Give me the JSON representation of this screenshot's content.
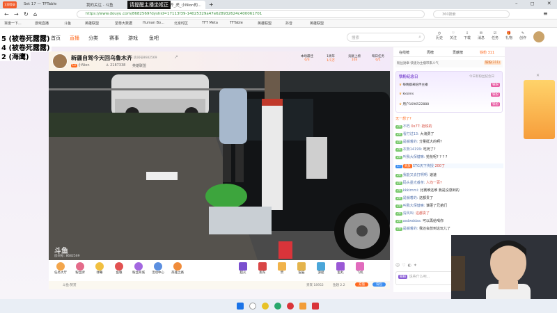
{
  "browser": {
    "login_button": "立即登录",
    "tabs": [
      {
        "label": "Set 17 — TFTable"
      },
      {
        "label": "我的关注 - 斗鱼"
      },
      {
        "label": "请提醒主播坐姬正"
      },
      {
        "label": "新疆自驾今天回乌鲁木齐_虎_小Nion的..."
      }
    ],
    "url": "https://www.douyu.com/8682569?dyshid=17113f39-14025329a47e628932624c400061701",
    "search_placeholder": "360搜索",
    "bookmarks": [
      "百度一下...",
      "游戏直播",
      "斗鱼",
      "英雄联盟",
      "至尊大数据",
      "Human Bo...",
      "北京时区",
      "TFT Meta",
      "TFTable",
      "英雄联盟",
      "抖音",
      "英雄联盟"
    ]
  },
  "overlay": {
    "tab_warning": "请提醒主播坐姬正",
    "lines": [
      "5 (被卷死露露)",
      "4 (被卷死露露)",
      "2 (海鹰)"
    ]
  },
  "site": {
    "nav": [
      "首页",
      "直播",
      "分类",
      "赛事",
      "游戏",
      "鱼吧"
    ],
    "search_placeholder": "搜索",
    "user_items": [
      "历史",
      "关注",
      "下载",
      "消息",
      "任务",
      "礼物",
      "创作"
    ]
  },
  "stream": {
    "title": "新疆自驾今天回乌鲁木齐",
    "room_id": "房间号8682569",
    "streamer": "小Nion",
    "followers": "2187338",
    "category": "英雄联盟",
    "stats": [
      {
        "label": "本场最佳",
        "value": "0/3"
      },
      {
        "label": "1周年",
        "value": "1/1万"
      },
      {
        "label": "贡献上榜",
        "value": "103"
      },
      {
        "label": "每日任务",
        "value": "0/1"
      }
    ],
    "watermark": "斗鱼",
    "room_label": "房间号: 8682569",
    "info": [
      "斗鱼:赞赏",
      "贵宾 18952",
      "鱼翅 2.2"
    ],
    "recharge_label": "充值",
    "fan_label": "背包"
  },
  "gifts": [
    {
      "name": "任务大厅"
    },
    {
      "name": "粉丝牌"
    },
    {
      "name": "弹幕"
    },
    {
      "name": "鱼粮"
    },
    {
      "name": "粉丝商城"
    },
    {
      "name": "活动中心"
    },
    {
      "name": "英雄之路"
    },
    {
      "name": "超火"
    },
    {
      "name": "跑车"
    },
    {
      "name": "赞"
    },
    {
      "name": "猫猫"
    },
    {
      "name": "游艇"
    },
    {
      "name": "鱼丸"
    },
    {
      "name": "飞机"
    }
  ],
  "chat": {
    "tabs": [
      "在线榜",
      "周榜",
      "贡献榜",
      "铁粉 311"
    ],
    "header_banner": "粉丝勋章 快速为主播带来人气",
    "fan_tag": "铁粉(311)",
    "vip_title": "铁粉纪念日",
    "vip_link": "今日有粉丝纪念日",
    "vip_users": [
      {
        "name": "每晚都来陪伴主播"
      },
      {
        "name": "kkkims"
      },
      {
        "name": "用户1696522888"
      }
    ],
    "messages": [
      {
        "user": "无一想了?",
        "text": ""
      },
      {
        "user": "不朽",
        "text": "0x7T: 抢铁的"
      },
      {
        "user": "看打过13:",
        "text": "大浪费了"
      },
      {
        "user": "是躺着的:",
        "text": "分量挺大的啊?"
      },
      {
        "user": "灰熊14199:",
        "text": "吃死了?"
      },
      {
        "user": "叫我大保健嘛:",
        "text": "抢抢呢? ? ? ?"
      },
      {
        "user": "STG天下传授",
        "text": "200了"
      },
      {
        "user": "我能又去打啊啊:",
        "text": "速速"
      },
      {
        "user": "码头墨光番茶:",
        "text": "人均一百?"
      },
      {
        "user": "kkkimmi:",
        "text": "比赛难还难 我是没感到的"
      },
      {
        "user": "是躺着的:",
        "text": "这都贵了"
      },
      {
        "user": "叫我大保健嘛:",
        "text": "谁砸了兄弟们"
      },
      {
        "user": "清风叫:",
        "text": "这都贵了"
      },
      {
        "user": "asdwddas:",
        "text": "可以再给喝你"
      },
      {
        "user": "是躺着的:",
        "text": "我还会放到这玩儿了"
      }
    ],
    "input_placeholder": "说些什么吧...",
    "send_label": "发送"
  },
  "colors": {
    "accent": "#ff6a1f",
    "purple": "#8a5cd6",
    "chrome": "#dfe3e8"
  }
}
